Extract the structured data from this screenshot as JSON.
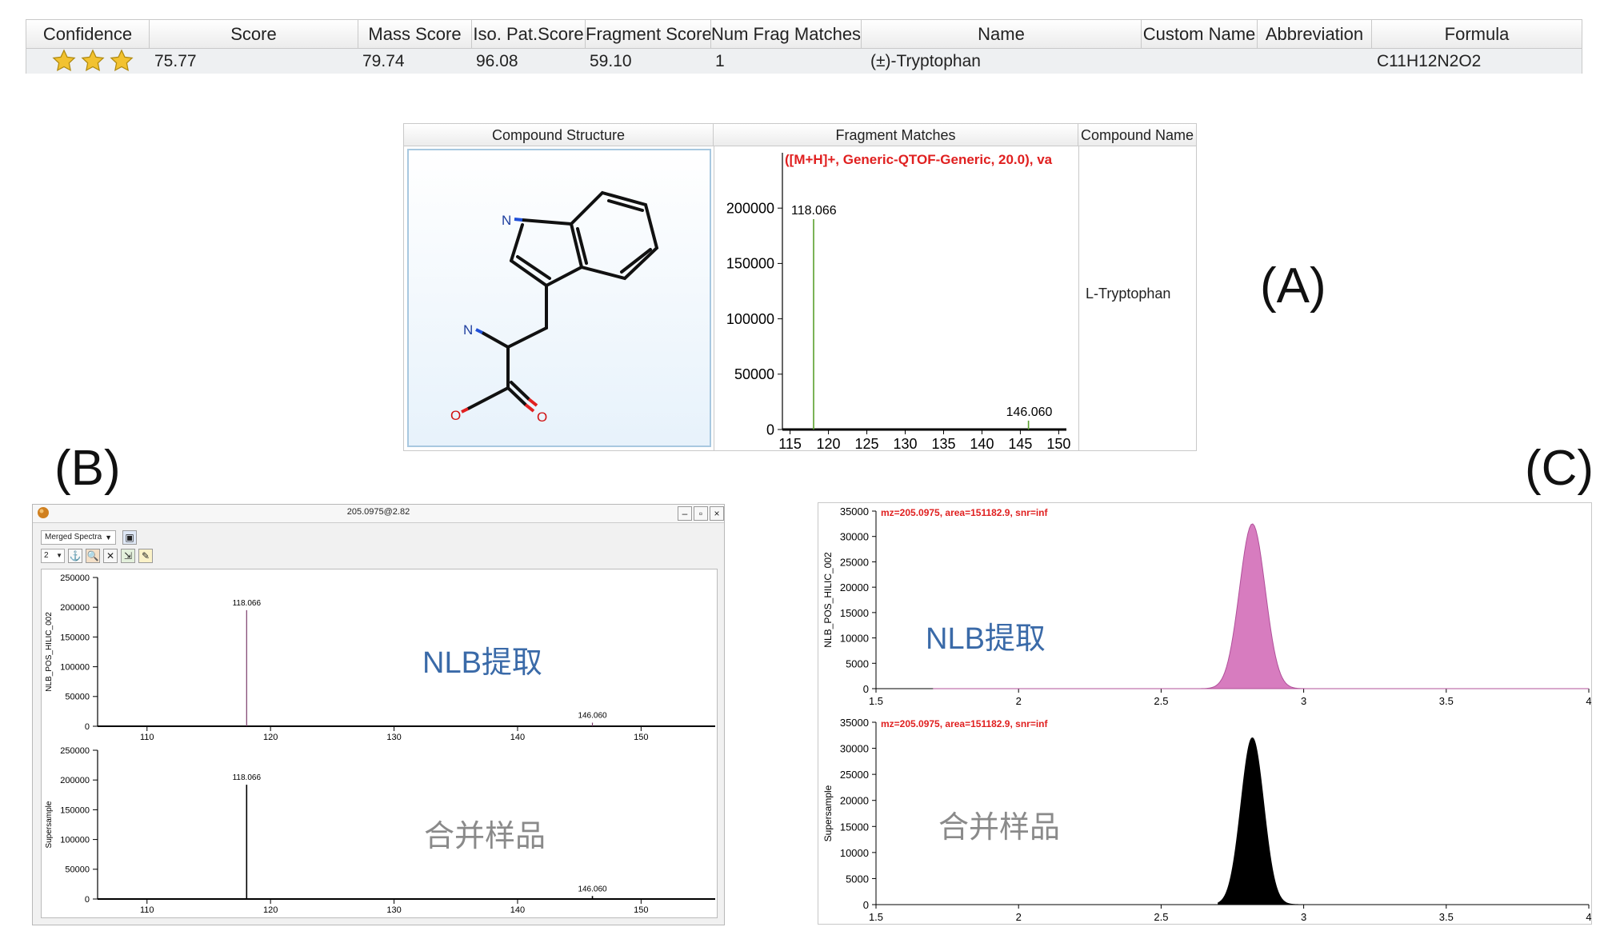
{
  "results": {
    "columns": [
      "Confidence",
      "Score",
      "Mass Score",
      "Iso. Pat.Score",
      "Fragment Score",
      "Num Frag Matches",
      "Name",
      "Custom Name",
      "Abbreviation",
      "Formula"
    ],
    "row": {
      "confidence_stars": 3,
      "score": "75.77",
      "mass_score": "79.74",
      "iso_score": "96.08",
      "fragment_score": "59.10",
      "num_frag_matches": "1",
      "name": "(±)-Tryptophan",
      "custom_name": "",
      "abbreviation": "",
      "formula": "C11H12N2O2"
    },
    "star_color": "#f2c230"
  },
  "panel": {
    "headers": [
      "Compound Structure",
      "Fragment Matches",
      "Compound Name"
    ],
    "compound_name": "L-Tryptophan",
    "atoms": {
      "n_ring": "N",
      "n_amine": "N",
      "o1": "O",
      "o2": "O"
    }
  },
  "labels": {
    "a": "(A)",
    "b": "(B)",
    "c": "(C)"
  },
  "windowB": {
    "title": "205.0975@2.82",
    "dropdown": "Merged Spectra",
    "count_dropdown": "2"
  },
  "watermarks": {
    "nlb": "NLB提取",
    "merged": "合并样品"
  },
  "chart_data": [
    {
      "id": "fragment-matches",
      "type": "bar",
      "title": "([M+H]+, Generic-QTOF-Generic, 20.0), va",
      "x": [
        118.066,
        146.06
      ],
      "values": [
        190000,
        8000
      ],
      "point_labels": [
        "118.066",
        "146.060"
      ],
      "xlim": [
        114,
        151
      ],
      "ylim": [
        0,
        250000
      ],
      "xticks": [
        115,
        120,
        125,
        130,
        135,
        140,
        145,
        150
      ],
      "yticks": [
        0,
        50000,
        100000,
        150000,
        200000
      ],
      "color": "#5aa02c"
    },
    {
      "id": "spectrum-nlb",
      "type": "bar",
      "ylabel": "NLB_POS_HILIC_002",
      "x": [
        118.066,
        146.06
      ],
      "values": [
        195000,
        6000
      ],
      "point_labels": [
        "118.066",
        "146.060"
      ],
      "xlim": [
        106,
        156
      ],
      "ylim": [
        0,
        250000
      ],
      "xticks": [
        110,
        120,
        130,
        140,
        150
      ],
      "yticks": [
        0,
        50000,
        100000,
        150000,
        200000,
        250000
      ],
      "color": "#7b3b6a"
    },
    {
      "id": "spectrum-supersample",
      "type": "bar",
      "ylabel": "Supersample",
      "x": [
        118.066,
        146.06
      ],
      "values": [
        192000,
        5000
      ],
      "point_labels": [
        "118.066",
        "146.060"
      ],
      "xlim": [
        106,
        156
      ],
      "ylim": [
        0,
        250000
      ],
      "xticks": [
        110,
        120,
        130,
        140,
        150
      ],
      "yticks": [
        0,
        50000,
        100000,
        150000,
        200000,
        250000
      ],
      "color": "#000000"
    },
    {
      "id": "chromatogram-nlb",
      "type": "area",
      "title": "mz=205.0975, area=151182.9, snr=inf",
      "ylabel": "NLB_POS_HILIC_002",
      "peak": {
        "rt": 2.82,
        "height": 32500,
        "width": 0.045
      },
      "baseline_range": [
        1.7,
        4.0
      ],
      "xlim": [
        1.5,
        4.0
      ],
      "ylim": [
        0,
        35000
      ],
      "xticks": [
        1.5,
        2,
        2.5,
        3,
        3.5,
        4
      ],
      "yticks": [
        0,
        5000,
        10000,
        15000,
        20000,
        25000,
        30000,
        35000
      ],
      "color": "#d77cbf"
    },
    {
      "id": "chromatogram-supersample",
      "type": "area",
      "title": "mz=205.0975, area=151182.9, snr=inf",
      "ylabel": "Supersample",
      "peak": {
        "rt": 2.82,
        "height": 32000,
        "width": 0.04
      },
      "baseline_range": [
        2.7,
        3.0
      ],
      "xlim": [
        1.5,
        4.0
      ],
      "ylim": [
        0,
        35000
      ],
      "xticks": [
        1.5,
        2,
        2.5,
        3,
        3.5,
        4
      ],
      "yticks": [
        0,
        5000,
        10000,
        15000,
        20000,
        25000,
        30000,
        35000
      ],
      "color": "#000000"
    }
  ]
}
